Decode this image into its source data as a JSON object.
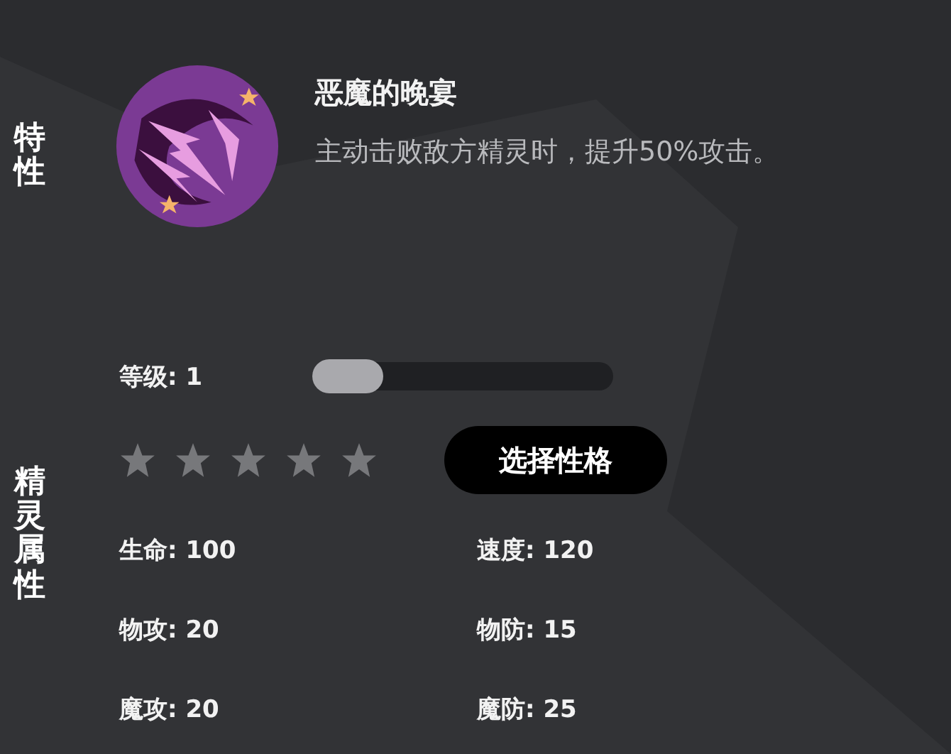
{
  "trait": {
    "label": "特性",
    "name": "恶魔的晚宴",
    "description": "主动击败敌方精灵时，提升50%攻击。"
  },
  "attributes": {
    "label": "精灵属性",
    "level_text": "等级: 1",
    "level": 0,
    "stars": 0,
    "button": "选择性格",
    "stats": [
      {
        "text": "生命: 100"
      },
      {
        "text": "速度: 120"
      },
      {
        "text": "物攻: 20"
      },
      {
        "text": "物防: 15"
      },
      {
        "text": "魔攻: 20"
      },
      {
        "text": "魔防: 25"
      }
    ]
  }
}
